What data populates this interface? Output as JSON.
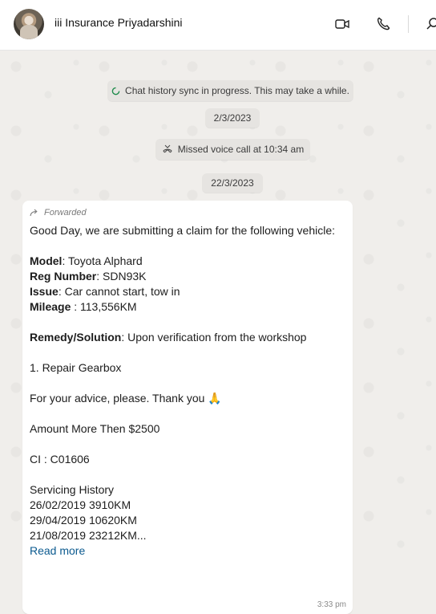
{
  "header": {
    "contact_name": "iii Insurance Priyadarshini",
    "icons": [
      "avatar",
      "video-call-icon",
      "voice-call-icon",
      "search-icon"
    ]
  },
  "chat": {
    "sync_notice": "Chat history sync in progress. This may take a while.",
    "date_1": "2/3/2023",
    "missed_call": "Missed voice call at 10:34 am",
    "date_2": "22/3/2023",
    "message": {
      "forwarded_label": "Forwarded",
      "greeting": "Good Day, we are submitting a claim for the following vehicle:",
      "model_label": "Model",
      "model_value": ": Toyota Alphard",
      "reg_label": "Reg Number",
      "reg_value": ": SDN93K",
      "issue_label": "Issue",
      "issue_value": ": Car cannot start, tow in",
      "mileage_label": "Mileage",
      "mileage_value": " : 113,556KM",
      "remedy_label": "Remedy/Solution",
      "remedy_value": ": Upon verification from the workshop",
      "repair": "1. Repair Gearbox",
      "advice": "For your advice, please. Thank you 🙏",
      "amount": "Amount More Then $2500",
      "ci": "CI : C01606",
      "servicing_title": "Servicing History",
      "service_1": "26/02/2019 3910KM",
      "service_2": "29/04/2019 10620KM",
      "service_3": "21/08/2019 23212KM...",
      "read_more": "Read more",
      "time": "3:33 pm"
    }
  },
  "colors": {
    "chat_background": "#f0eeeb",
    "bubble": "#ffffff",
    "link": "#0b5a8f",
    "system_bubble": "#e6e4e1"
  }
}
